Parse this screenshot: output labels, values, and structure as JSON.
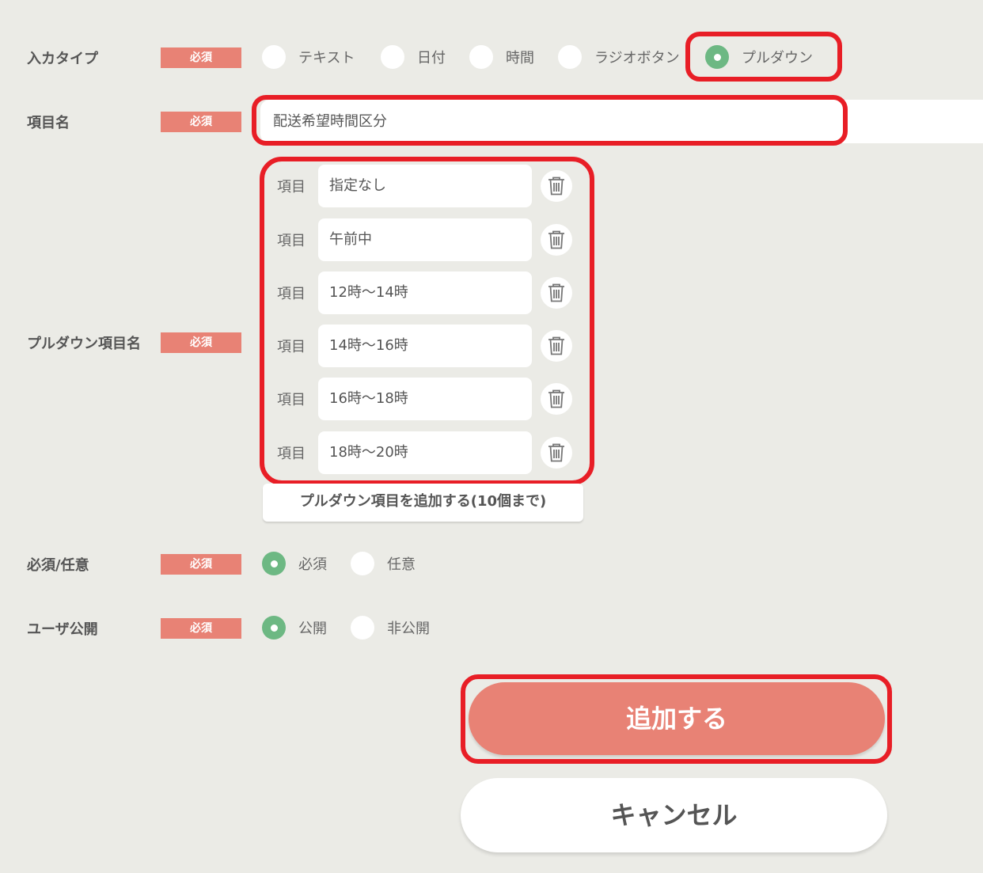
{
  "required_badge": "必須",
  "input_type": {
    "label": "入カタイプ",
    "options": [
      "テキスト",
      "日付",
      "時間",
      "ラジオボタン",
      "プルダウン"
    ],
    "selected": "プルダウン"
  },
  "item_name": {
    "label": "項目名",
    "value": "配送希望時間区分"
  },
  "pulldown_items": {
    "label": "プルダウン項目名",
    "row_label": "項目",
    "items": [
      "指定なし",
      "午前中",
      "12時～14時",
      "14時～16時",
      "16時～18時",
      "18時～20時"
    ],
    "add_button": "プルダウン項目を追加する(10個まで)"
  },
  "required_optional": {
    "label": "必須/任意",
    "options": [
      "必須",
      "任意"
    ],
    "selected": "必須"
  },
  "user_public": {
    "label": "ユーザ公開",
    "options": [
      "公開",
      "非公開"
    ],
    "selected": "公開"
  },
  "buttons": {
    "submit": "追加する",
    "cancel": "キャンセル"
  },
  "colors": {
    "badge": "#e88275",
    "radio_checked": "#6db883",
    "highlight": "#e81e26",
    "background": "#ebebe6"
  }
}
